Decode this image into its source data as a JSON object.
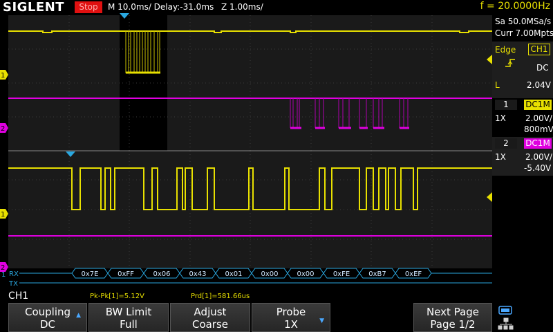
{
  "topbar": {
    "brand": "SIGLENT",
    "run_state": "Stop",
    "timebase": "M 10.0ms/ Delay:-31.0ms",
    "zoom": "Z 1.00ms/",
    "frequency": "f = 20.0000Hz"
  },
  "acquisition": {
    "sample_rate": "Sa 50.0MSa/s",
    "memory": "Curr 7.00Mpts"
  },
  "trigger": {
    "type": "Edge",
    "source": "CH1",
    "coupling": "DC",
    "level_label": "L",
    "level": "2.04V"
  },
  "channel1": {
    "number": "1",
    "coupling": "DC1M",
    "probe": "1X",
    "scale": "2.00V/",
    "offset": "800mV",
    "color": "#e8e000"
  },
  "channel2": {
    "number": "2",
    "coupling": "DC1M",
    "probe": "1X",
    "scale": "2.00V/",
    "offset": "-5.40V",
    "color": "#e000e0"
  },
  "decode": {
    "rx_label": "RX",
    "tx_label": "TX",
    "bytes": [
      "0x7E",
      "0xFF",
      "0x06",
      "0x43",
      "0x01",
      "0x00",
      "0x00",
      "0xFE",
      "0xB7",
      "0xEF"
    ],
    "color": "#2aa8e0"
  },
  "marker_labels": {
    "ch1": "1",
    "ch2": "2"
  },
  "measurements": {
    "active_channel": "CH1",
    "pkpk": "Pk-Pk[1]=5.12V",
    "period": "Prd[1]=581.66us"
  },
  "softkeys": [
    {
      "line1": "Coupling",
      "line2": "DC"
    },
    {
      "line1": "BW Limit",
      "line2": "Full"
    },
    {
      "line1": "Adjust",
      "line2": "Coarse"
    },
    {
      "line1": "Probe",
      "line2": "1X"
    },
    {
      "line1": "Next Page",
      "line2": "Page 1/2"
    }
  ]
}
